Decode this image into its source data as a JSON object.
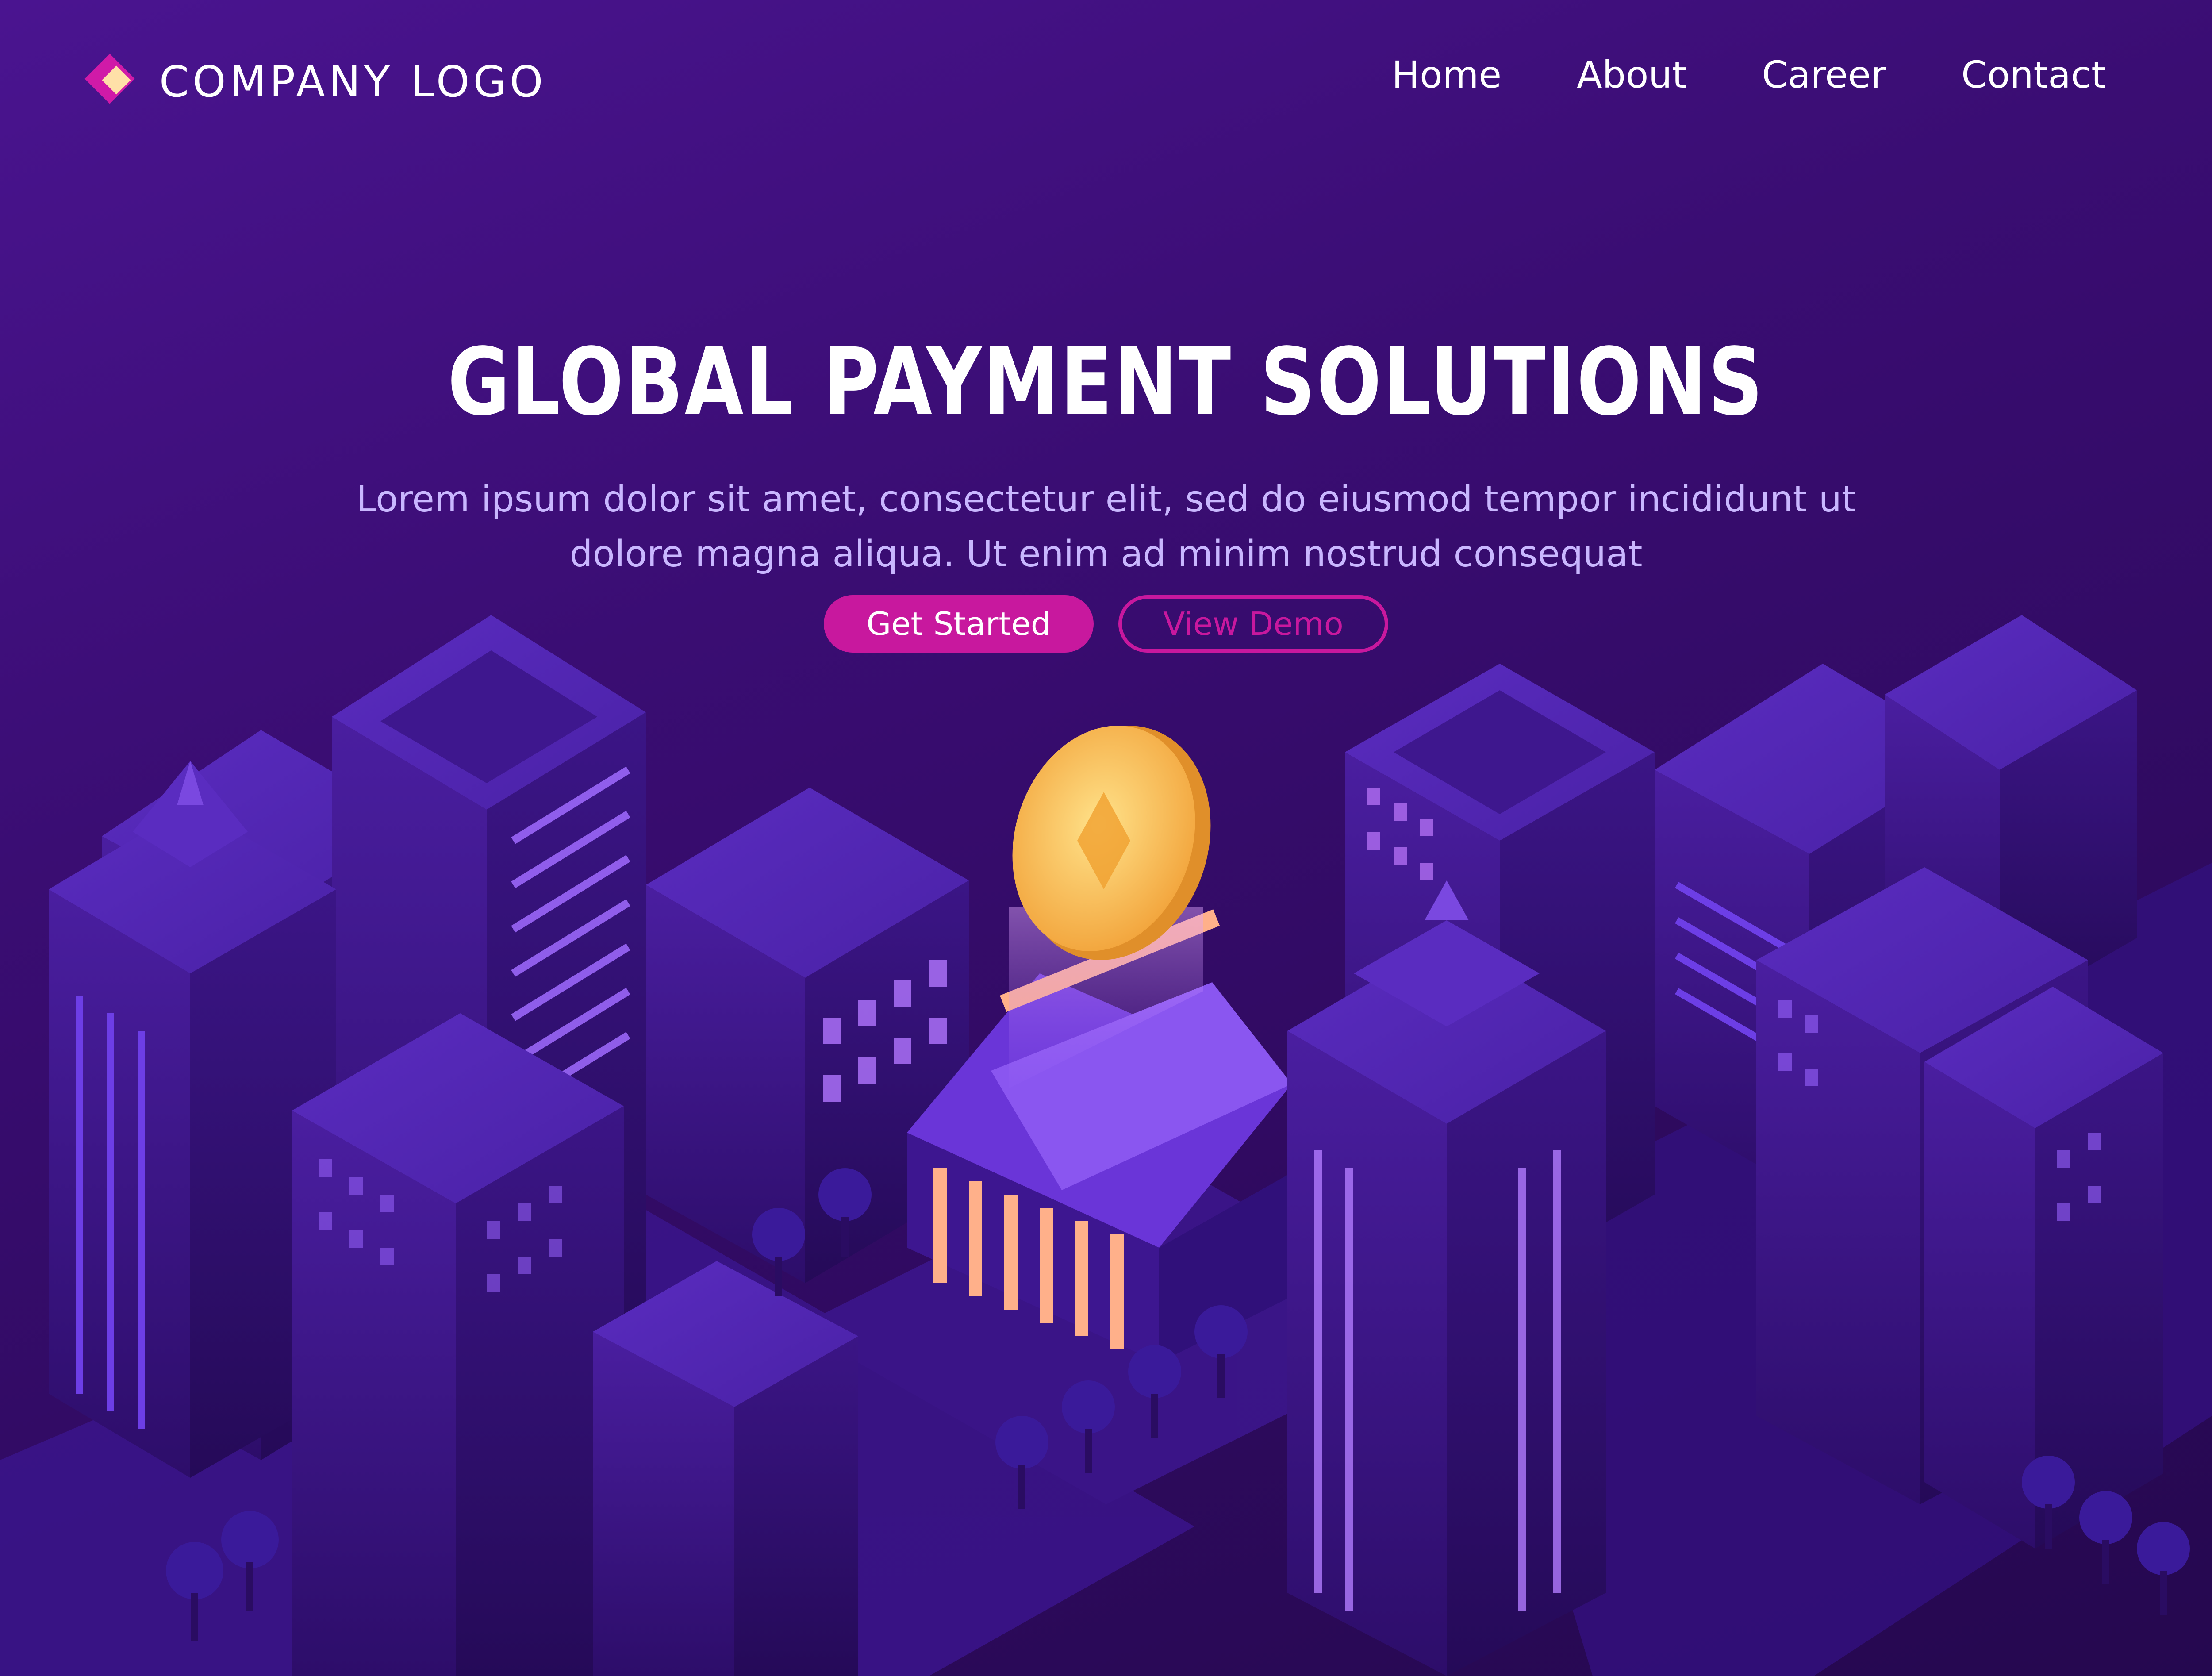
{
  "brand": {
    "name": "COMPANY LOGO"
  },
  "nav": {
    "items": [
      "Home",
      "About",
      "Career",
      "Contact"
    ]
  },
  "hero": {
    "title": "GLOBAL PAYMENT SOLUTIONS",
    "subtitle": "Lorem ipsum dolor sit amet, consectetur elit, sed do eiusmod tempor incididunt ut dolore magna aliqua. Ut enim ad minim nostrud consequat",
    "primary_button": "Get Started",
    "secondary_button": "View Demo"
  },
  "colors": {
    "accent": "#c8189e",
    "logo_diamond": "#ffe0a8",
    "coin": "#f2b24a",
    "background": "#3a0d73"
  }
}
